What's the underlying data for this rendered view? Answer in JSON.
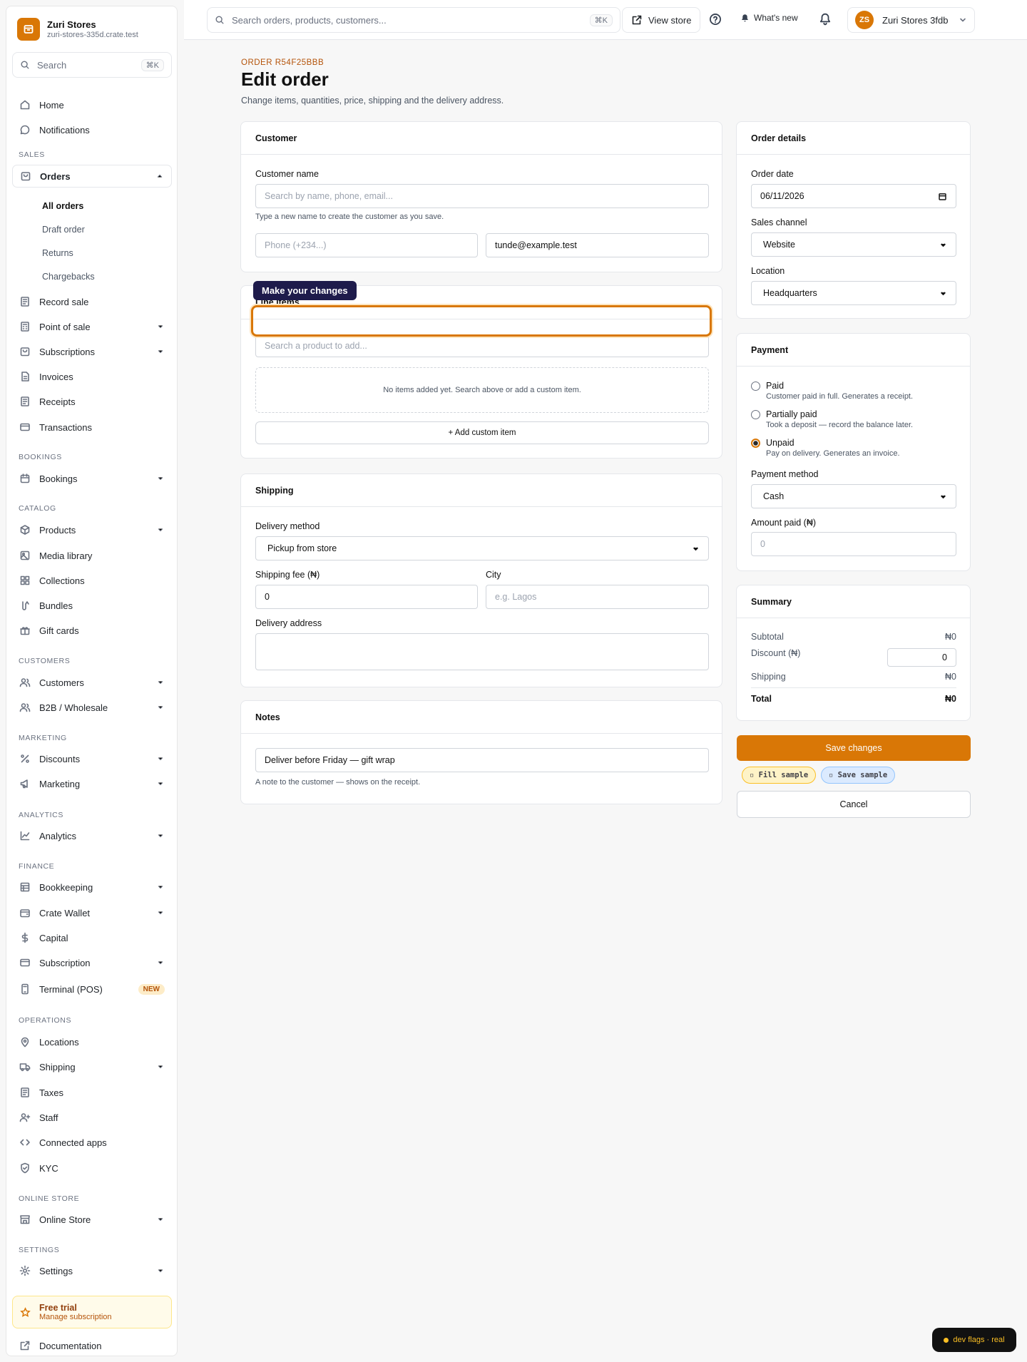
{
  "store": {
    "name": "Zuri Stores",
    "domain": "zuri-stores-335d.crate.test"
  },
  "sidebar": {
    "search_label": "Search",
    "search_shortcut": "⌘K",
    "home": "Home",
    "notifications": "Notifications",
    "sections": {
      "sales": "SALES",
      "bookings": "BOOKINGS",
      "catalog": "CATALOG",
      "customers": "CUSTOMERS",
      "marketing": "MARKETING",
      "analytics": "ANALYTICS",
      "finance": "FINANCE",
      "operations": "OPERATIONS",
      "online_store": "ONLINE STORE",
      "settings": "SETTINGS"
    },
    "orders": "Orders",
    "orders_sub": [
      "All orders",
      "Draft order",
      "Returns",
      "Chargebacks"
    ],
    "record_sale": "Record sale",
    "point_of_sale": "Point of sale",
    "subscriptions": "Subscriptions",
    "invoices": "Invoices",
    "receipts": "Receipts",
    "transactions": "Transactions",
    "bookings_item": "Bookings",
    "products": "Products",
    "media_library": "Media library",
    "collections": "Collections",
    "bundles": "Bundles",
    "gift_cards": "Gift cards",
    "customers_item": "Customers",
    "b2b": "B2B / Wholesale",
    "discounts": "Discounts",
    "marketing_item": "Marketing",
    "analytics_item": "Analytics",
    "bookkeeping": "Bookkeeping",
    "crate_wallet": "Crate Wallet",
    "capital": "Capital",
    "subscription": "Subscription",
    "terminal": "Terminal (POS)",
    "terminal_badge": "NEW",
    "locations": "Locations",
    "shipping": "Shipping",
    "taxes": "Taxes",
    "staff": "Staff",
    "connected_apps": "Connected apps",
    "kyc": "KYC",
    "online_store_item": "Online Store",
    "settings_item": "Settings",
    "trial_title": "Free trial",
    "trial_sub": "Manage subscription",
    "documentation": "Documentation"
  },
  "topbar": {
    "search_placeholder": "Search orders, products, customers...",
    "search_shortcut": "⌘K",
    "view_store": "View store",
    "whats_new": "What's new",
    "avatar_initials": "ZS",
    "account_name": "Zuri Stores 3fdb"
  },
  "page": {
    "order_code": "ORDER R54F25BBB",
    "title": "Edit order",
    "description": "Change items, quantities, price, shipping and the delivery address."
  },
  "customer": {
    "heading": "Customer",
    "name_label": "Customer name",
    "name_placeholder": "Search by name, phone, email...",
    "hint": "Type a new name to create the customer as you save.",
    "phone_placeholder": "Phone (+234...)",
    "email_value": "tunde@example.test"
  },
  "line_items": {
    "tooltip": "Make your changes",
    "heading": "Line items",
    "search_placeholder": "Search a product to add...",
    "empty": "No items added yet. Search above or add a custom item.",
    "add_custom": "+ Add custom item"
  },
  "shipping": {
    "heading": "Shipping",
    "method_label": "Delivery method",
    "method_value": "Pickup from store",
    "fee_label": "Shipping fee (₦)",
    "fee_value": "0",
    "city_label": "City",
    "city_placeholder": "e.g. Lagos",
    "address_label": "Delivery address"
  },
  "notes": {
    "heading": "Notes",
    "value": "Deliver before Friday — gift wrap",
    "hint": "A note to the customer — shows on the receipt."
  },
  "order_details": {
    "heading": "Order details",
    "date_label": "Order date",
    "date_value": "06/11/2026",
    "channel_label": "Sales channel",
    "channel_value": "Website",
    "location_label": "Location",
    "location_value": "Headquarters"
  },
  "payment": {
    "heading": "Payment",
    "options": [
      {
        "title": "Paid",
        "sub": "Customer paid in full. Generates a receipt.",
        "selected": false
      },
      {
        "title": "Partially paid",
        "sub": "Took a deposit — record the balance later.",
        "selected": false
      },
      {
        "title": "Unpaid",
        "sub": "Pay on delivery. Generates an invoice.",
        "selected": true
      }
    ],
    "method_label": "Payment method",
    "method_value": "Cash",
    "amount_label": "Amount paid (₦)",
    "amount_placeholder": "0"
  },
  "summary": {
    "heading": "Summary",
    "subtotal_label": "Subtotal",
    "subtotal_value": "₦0",
    "discount_label": "Discount (₦)",
    "discount_value": "0",
    "shipping_label": "Shipping",
    "shipping_value": "₦0",
    "total_label": "Total",
    "total_value": "₦0"
  },
  "actions": {
    "save": "Save changes",
    "fill_sample": "▫ Fill sample",
    "save_sample": "▫ Save sample",
    "cancel": "Cancel",
    "dev_flags": "dev flags · real"
  },
  "colors": {
    "accent": "#d97706",
    "tooltip_bg": "#1e1b4b"
  }
}
